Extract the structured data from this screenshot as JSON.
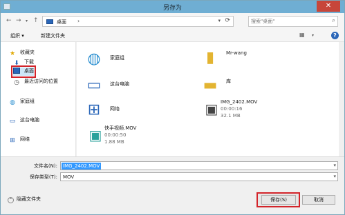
{
  "window": {
    "title": "另存为",
    "close_label": "✕"
  },
  "address": {
    "location": "桌面",
    "separator": "›"
  },
  "search": {
    "placeholder": "搜索\"桌面\""
  },
  "toolbar": {
    "organize": "组织 ▾",
    "new_folder": "新建文件夹"
  },
  "sidebar": {
    "items": [
      {
        "label": "收藏夹",
        "icon": "star-icon"
      },
      {
        "label": "下载",
        "icon": "downloads-icon"
      },
      {
        "label": "桌面",
        "icon": "desktop-icon",
        "selected": true
      },
      {
        "label": "最近访问的位置",
        "icon": "recent-places-icon"
      },
      {
        "label": "家庭组",
        "icon": "homegroup-icon"
      },
      {
        "label": "这台电脑",
        "icon": "computer-icon"
      },
      {
        "label": "网络",
        "icon": "network-icon"
      }
    ]
  },
  "files": [
    {
      "name": "家庭组",
      "icon": "homegroup-icon"
    },
    {
      "name": "Mr-wang",
      "icon": "user-folder-icon"
    },
    {
      "name": "这台电脑",
      "icon": "computer-icon"
    },
    {
      "name": "库",
      "icon": "library-icon"
    },
    {
      "name": "网络",
      "icon": "network-icon"
    },
    {
      "name": "IMG_2402.MOV",
      "icon": "video-file-icon",
      "meta1": "00:00:16",
      "meta2": "32.1 MB"
    },
    {
      "name": "快手视频.MOV",
      "icon": "video-file-icon",
      "meta1": "00:00:50",
      "meta2": "1.88 MB"
    }
  ],
  "form": {
    "filename_label": "文件名(N):",
    "filename_value": "IMG_2402.MOV",
    "filetype_label": "保存类型(T):",
    "filetype_value": "MOV"
  },
  "footer": {
    "hide_folders": "隐藏文件夹",
    "save_button": "保存(S)",
    "cancel_button": "取消"
  },
  "colors": {
    "titlebar": "#6faed3",
    "close": "#c7463a",
    "selection": "#3399ff",
    "highlight_frame": "#d3242a"
  }
}
